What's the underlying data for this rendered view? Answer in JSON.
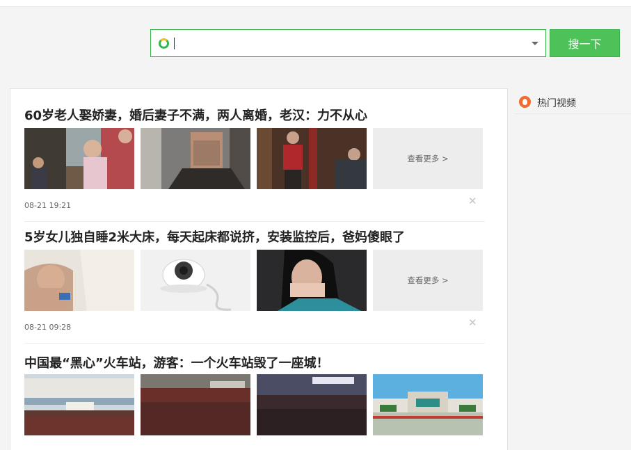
{
  "search": {
    "value": "",
    "button_label": "搜一下"
  },
  "sidebar": {
    "hot_videos_label": "热门视频"
  },
  "articles": [
    {
      "title": "60岁老人娶娇妻，婚后妻子不满，两人离婚，老汉：力不从心",
      "more_label": "查看更多 >",
      "time": "08-21 19:21"
    },
    {
      "title": "5岁女儿独自睡2米大床，每天起床都说挤，安装监控后，爸妈傻眼了",
      "more_label": "查看更多 >",
      "time": "08-21 09:28"
    },
    {
      "title": "中国最“黑心”火车站，游客：一个火车站毁了一座城！"
    }
  ],
  "colors": {
    "accent_green": "#4cc258",
    "hot_icon_orange": "#f26a2e"
  }
}
